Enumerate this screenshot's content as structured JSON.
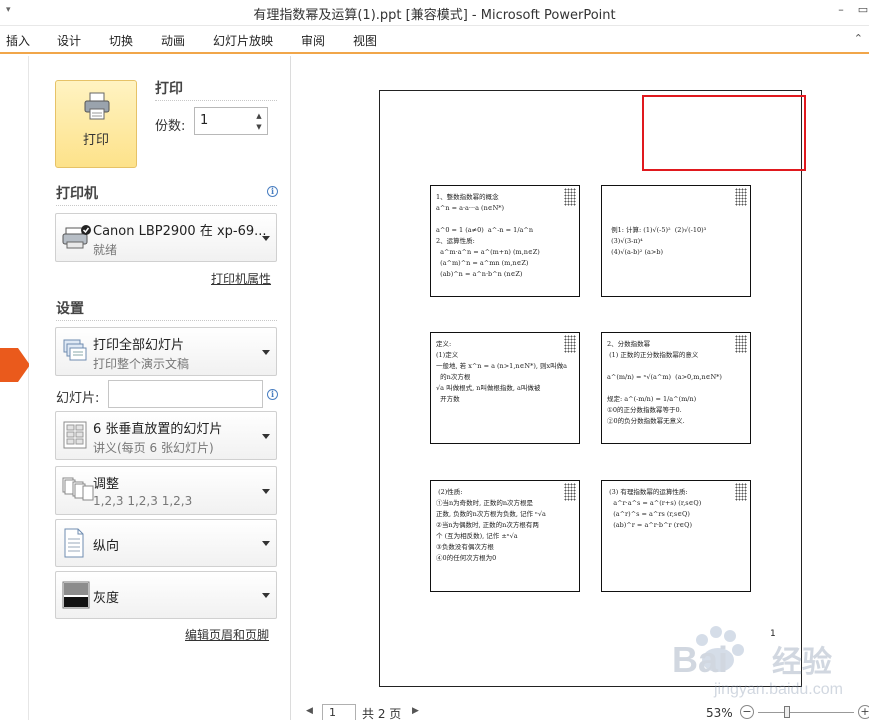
{
  "window": {
    "title": "有理指数幂及运算(1).ppt [兼容模式]  -  Microsoft PowerPoint",
    "minimize": "–",
    "restore": "▭"
  },
  "ribbon": {
    "tabs": [
      "插入",
      "设计",
      "切换",
      "动画",
      "幻灯片放映",
      "审阅",
      "视图"
    ]
  },
  "print": {
    "section_title": "打印",
    "button_label": "打印",
    "copies_label": "份数:",
    "copies_value": "1"
  },
  "printer": {
    "section_title": "打印机",
    "name": "Canon LBP2900 在 xp-69...",
    "status": "就绪",
    "properties_link": "打印机属性"
  },
  "settings": {
    "section_title": "设置",
    "range": {
      "title": "打印全部幻灯片",
      "subtitle": "打印整个演示文稿"
    },
    "slides_label": "幻灯片:",
    "slides_value": "",
    "layout": {
      "title": "6 张垂直放置的幻灯片",
      "subtitle": "讲义(每页 6 张幻灯片)"
    },
    "collate": {
      "title": "调整",
      "subtitle": "1,2,3    1,2,3    1,2,3"
    },
    "orientation": {
      "title": "纵向"
    },
    "color": {
      "title": "灰度"
    },
    "header_footer_link": "编辑页眉和页脚"
  },
  "preview": {
    "page_number_on_sheet": "1",
    "thumbnails": [
      {
        "text": "1、整数指数幂的概念\na^n = a·a···a (n∈N*)\n\na^0 = 1 (a≠0)  a^-n = 1/a^n\n2、运算性质:\n  a^m·a^n = a^(m+n) (m,n∈Z)\n  (a^m)^n = a^mn (m,n∈Z)\n  (ab)^n = a^n·b^n (n∈Z)"
      },
      {
        "text": "\n\n\n  例1: 计算: (1)√(-5)²  (2)√(-10)³\n  (3)√(3-π)⁴\n  (4)√(a-b)² (a>b)"
      },
      {
        "text": "定义:\n(1)定义\n一般地, 若 x^n = a (n>1,n∈N*), 则x叫做a\n  的n次方根\n√a 叫做根式, n叫做根指数, a叫做被\n  开方数"
      },
      {
        "text": "2、分数指数幂\n (1) 正数的正分数指数幂的意义\n\na^(m/n) = ⁿ√(a^m)  (a>0,m,n∈N*)\n\n规定: a^(-m/n) = 1/a^(m/n)\n①0的正分数指数幂等于0.\n②0的负分数指数幂无意义."
      },
      {
        "text": " (2)性质:\n①当n为奇数时, 正数的n次方根是\n正数, 负数的n次方根为负数, 记作 ⁿ√a\n②当n为偶数时, 正数的n次方根有两\n个 (互为相反数), 记作 ±ⁿ√a\n③负数没有偶次方根\n④0的任何次方根为0"
      },
      {
        "text": " (3) 有理指数幂的运算性质:\n   a^r·a^s = a^(r+s) (r,s∈Q)\n   (a^r)^s = a^rs (r,s∈Q)\n   (ab)^r = a^r·b^r (r∈Q)"
      }
    ]
  },
  "navigation": {
    "current_page": "1",
    "total_pages": "共 2 页",
    "zoom": "53%",
    "zoom_level_percent": 53
  },
  "watermark": {
    "brand": "Baidu经验",
    "url": "jingyan.baidu.com"
  },
  "colors": {
    "accent_orange": "#f1a64a",
    "marker_orange": "#ea5a1c",
    "highlight_red": "#e0191e",
    "print_button_fill": "#fde28a"
  }
}
